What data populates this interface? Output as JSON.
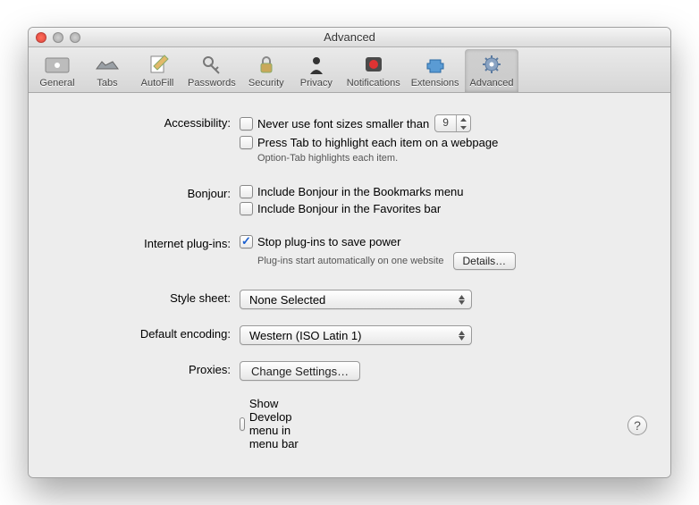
{
  "title": "Advanced",
  "toolbar": [
    {
      "name": "general",
      "label": "General"
    },
    {
      "name": "tabs",
      "label": "Tabs"
    },
    {
      "name": "autofill",
      "label": "AutoFill"
    },
    {
      "name": "passwords",
      "label": "Passwords"
    },
    {
      "name": "security",
      "label": "Security"
    },
    {
      "name": "privacy",
      "label": "Privacy"
    },
    {
      "name": "notifications",
      "label": "Notifications"
    },
    {
      "name": "extensions",
      "label": "Extensions"
    },
    {
      "name": "advanced",
      "label": "Advanced"
    }
  ],
  "accessibility": {
    "label": "Accessibility:",
    "never_font": "Never use font sizes smaller than",
    "font_size": "9",
    "press_tab": "Press Tab to highlight each item on a webpage",
    "hint": "Option-Tab highlights each item."
  },
  "bonjour": {
    "label": "Bonjour:",
    "bookmarks": "Include Bonjour in the Bookmarks menu",
    "favorites": "Include Bonjour in the Favorites bar"
  },
  "plugins": {
    "label": "Internet plug-ins:",
    "stop": "Stop plug-ins to save power",
    "hint": "Plug-ins start automatically on one website",
    "details": "Details…"
  },
  "stylesheet": {
    "label": "Style sheet:",
    "value": "None Selected"
  },
  "encoding": {
    "label": "Default encoding:",
    "value": "Western (ISO Latin 1)"
  },
  "proxies": {
    "label": "Proxies:",
    "button": "Change Settings…"
  },
  "develop": "Show Develop menu in menu bar",
  "help": "?"
}
